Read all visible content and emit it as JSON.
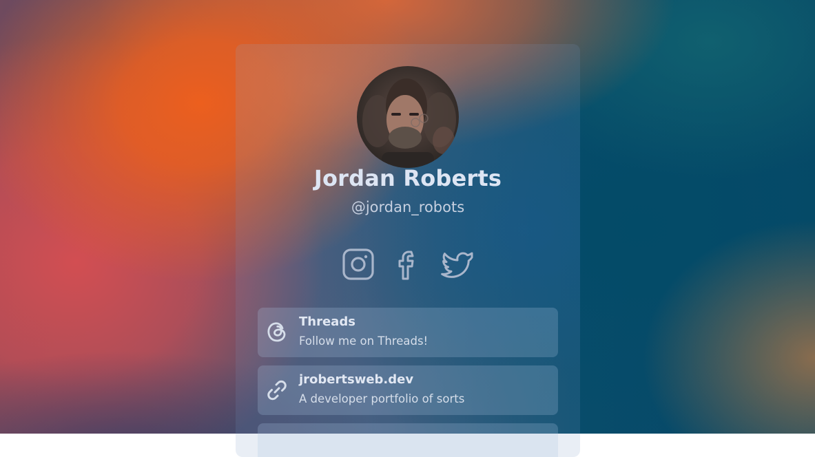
{
  "profile": {
    "name": "Jordan Roberts",
    "handle": "@jordan_robots"
  },
  "socials": [
    {
      "icon": "instagram-icon"
    },
    {
      "icon": "facebook-icon"
    },
    {
      "icon": "twitter-icon"
    }
  ],
  "links": [
    {
      "icon": "threads-icon",
      "title": "Threads",
      "description": "Follow me on Threads!"
    },
    {
      "icon": "link-icon",
      "title": "jrobertsweb.dev",
      "description": "A developer portfolio of sorts"
    },
    {
      "icon": "link-icon",
      "title": "",
      "description": ""
    }
  ],
  "colors": {
    "accent_orange": "#ec5f1e",
    "accent_blue": "#034b68",
    "text_light": "#dde5f3",
    "icon_muted": "#a9b6cb"
  }
}
